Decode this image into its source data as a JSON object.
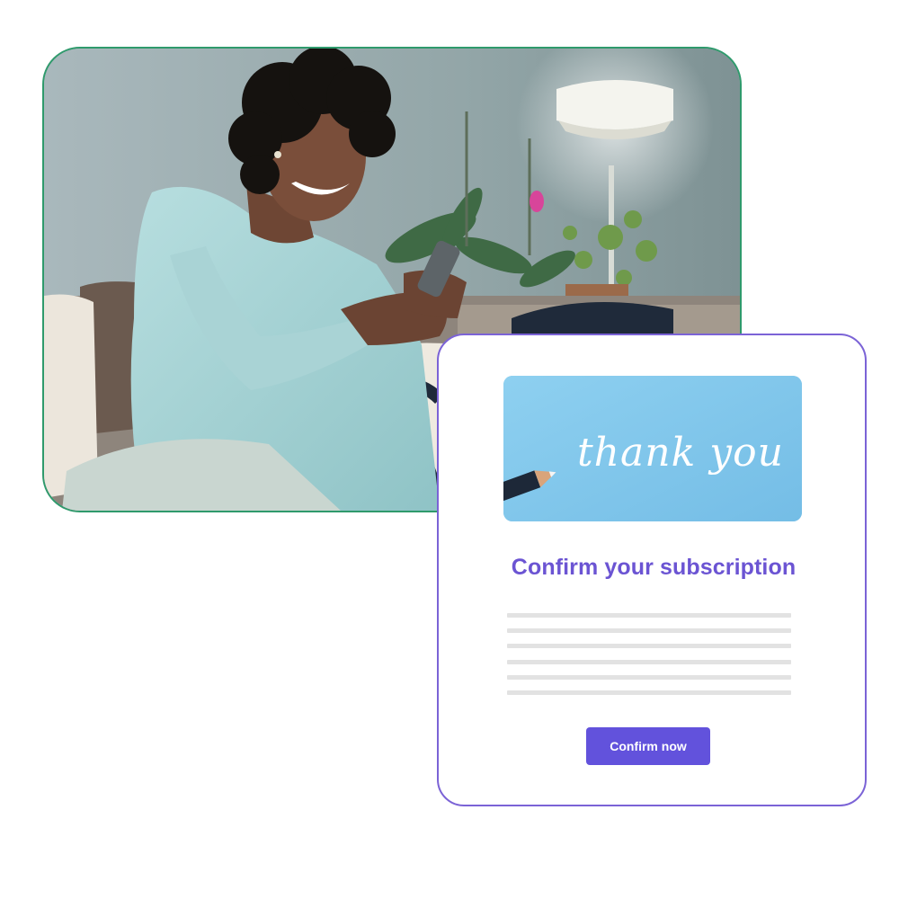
{
  "email": {
    "title": "Confirm your subscription",
    "button_label": "Confirm now",
    "hero_script_text": "thank you",
    "placeholder_line_count": 6
  },
  "colors": {
    "photo_border": "#2f9a6c",
    "email_border": "#7b63d6",
    "title": "#6b54d3",
    "button": "#6252dc",
    "hero_background": "#82c8eb",
    "placeholder_line": "#e2e2e2"
  }
}
